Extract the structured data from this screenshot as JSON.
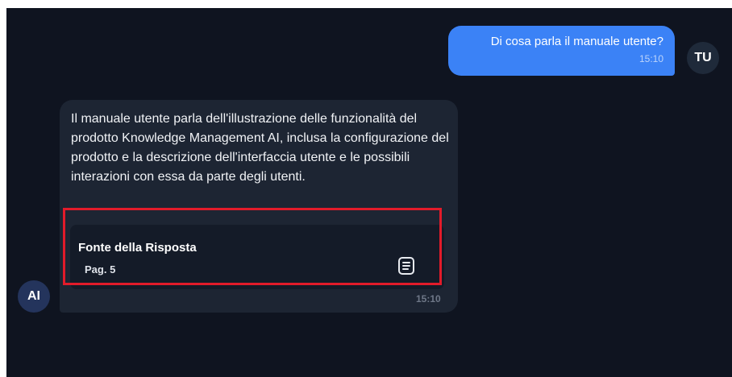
{
  "user_message": {
    "avatar": "TU",
    "text": "Di cosa parla il manuale utente?",
    "time": "15:10"
  },
  "ai_message": {
    "avatar": "AI",
    "text": "Il manuale utente parla dell'illustrazione delle funzionalità del prodotto Knowledge Management AI, inclusa la configurazione del prodotto e la descrizione dell'interfaccia utente e le possibili interazioni con essa da parte degli utenti.",
    "time": "15:10",
    "source": {
      "title": "Fonte della Risposta",
      "page": "Pag. 5",
      "icon": "document-icon"
    }
  },
  "colors": {
    "background": "#0f1420",
    "user_bubble": "#3b82f6",
    "ai_bubble": "#1d2533",
    "highlight": "#e21b2a"
  }
}
